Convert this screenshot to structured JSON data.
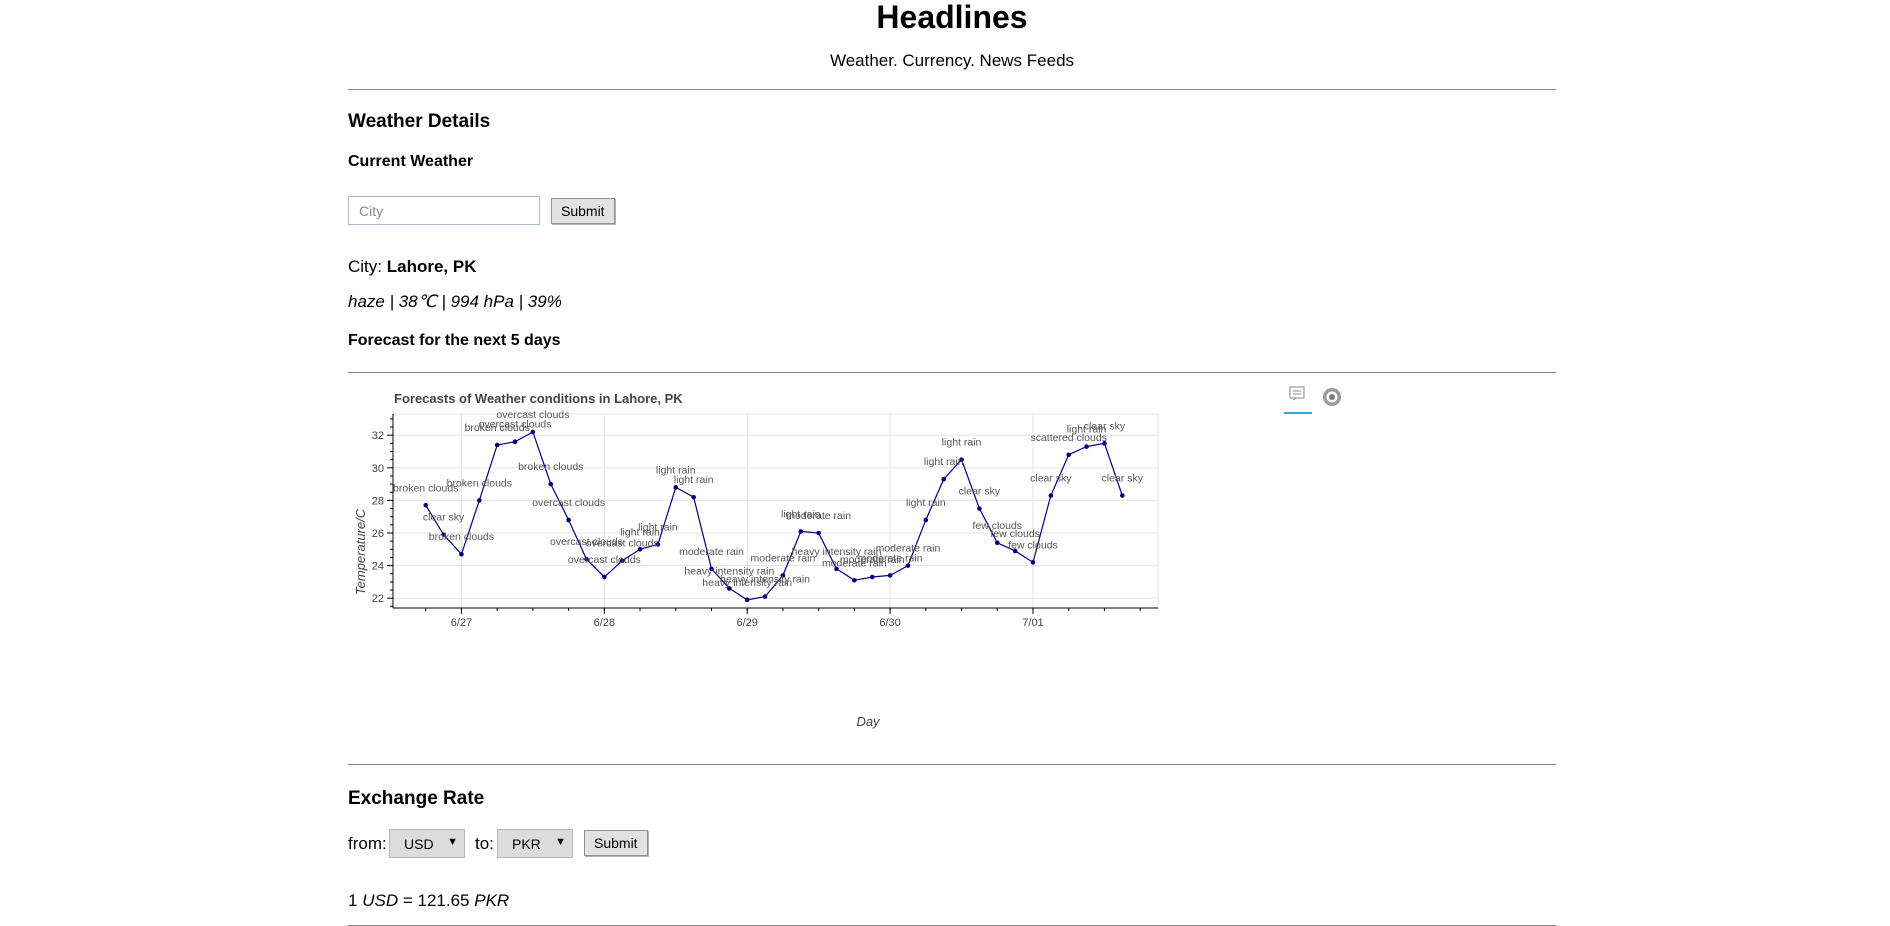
{
  "header": {
    "title": "Headlines",
    "subtitle": "Weather. Currency. News Feeds"
  },
  "weather": {
    "section_title": "Weather Details",
    "current_title": "Current Weather",
    "city_placeholder": "City",
    "submit_label": "Submit",
    "city_label": "City:",
    "city_value": "Lahore, PK",
    "summary": "haze | 38℃ | 994 hPa | 39%",
    "forecast_title": "Forecast for the next 5 days"
  },
  "chart_toolbar": {
    "icons": [
      "hover-tool-icon",
      "bokeh-logo-icon"
    ],
    "accent_color": "#26aae1"
  },
  "chart_data": {
    "type": "line",
    "title": "Forecasts of Weather conditions in Lahore, PK",
    "xlabel": "Day",
    "ylabel": "Temperature/C",
    "ylim": [
      21.4,
      33.3
    ],
    "xlim": [
      "06-26 12:30",
      "07-01 21:00"
    ],
    "yticks": [
      22,
      24,
      26,
      28,
      30,
      32
    ],
    "xticks": [
      "6/27",
      "6/28",
      "6/29",
      "6/30",
      "7/01"
    ],
    "grid": true,
    "line_color": "#000080",
    "x": [
      "06-26 18:00",
      "06-26 21:00",
      "06-27 00:00",
      "06-27 03:00",
      "06-27 06:00",
      "06-27 09:00",
      "06-27 12:00",
      "06-27 15:00",
      "06-27 18:00",
      "06-27 21:00",
      "06-28 00:00",
      "06-28 03:00",
      "06-28 06:00",
      "06-28 09:00",
      "06-28 12:00",
      "06-28 15:00",
      "06-28 18:00",
      "06-28 21:00",
      "06-29 00:00",
      "06-29 03:00",
      "06-29 06:00",
      "06-29 09:00",
      "06-29 12:00",
      "06-29 15:00",
      "06-29 18:00",
      "06-29 21:00",
      "06-30 00:00",
      "06-30 03:00",
      "06-30 06:00",
      "06-30 09:00",
      "06-30 12:00",
      "06-30 15:00",
      "06-30 18:00",
      "06-30 21:00",
      "07-01 00:00",
      "07-01 03:00",
      "07-01 06:00",
      "07-01 09:00",
      "07-01 12:00",
      "07-01 15:00"
    ],
    "values": [
      27.7,
      25.9,
      24.7,
      28.0,
      31.4,
      31.6,
      32.2,
      29.0,
      26.8,
      24.4,
      23.3,
      24.3,
      25.0,
      25.3,
      28.8,
      28.2,
      23.8,
      22.6,
      21.9,
      22.1,
      23.4,
      26.1,
      26.0,
      23.8,
      23.1,
      23.3,
      23.4,
      24.0,
      26.8,
      29.3,
      30.5,
      27.5,
      25.4,
      24.9,
      24.2,
      28.3,
      30.8,
      31.3,
      31.5,
      28.3
    ],
    "labels": [
      "broken clouds",
      "clear sky",
      "broken clouds",
      "broken clouds",
      "broken clouds",
      "overcast clouds",
      "overcast clouds",
      "broken clouds",
      "overcast clouds",
      "overcast clouds",
      "overcast clouds",
      "overcast clouds",
      "light rain",
      "light rain",
      "light rain",
      "light rain",
      "moderate rain",
      "heavy intensity rain",
      "heavy intensity rain",
      "heavy intensity rain",
      "moderate rain",
      "light rain",
      "moderate rain",
      "heavy intensity rain",
      "moderate rain",
      "moderate rain",
      "moderate rain",
      "moderate rain",
      "light rain",
      "light rain",
      "light rain",
      "clear sky",
      "few clouds",
      "few clouds",
      "few clouds",
      "clear sky",
      "scattered clouds",
      "light rain",
      "clear sky",
      "clear sky"
    ]
  },
  "exchange": {
    "section_title": "Exchange Rate",
    "from_label": "from:",
    "from_value": "USD",
    "to_label": "to:",
    "to_value": "PKR",
    "submit_label": "Submit",
    "result_amount": "1",
    "result_from": "USD",
    "result_eq": "= 121.65",
    "result_to": "PKR"
  }
}
